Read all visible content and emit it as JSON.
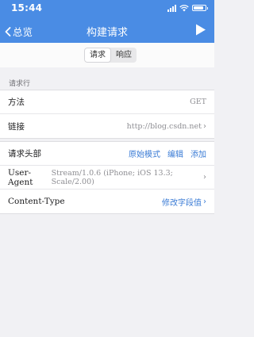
{
  "status": {
    "time": "15:44"
  },
  "nav": {
    "back_label": "总览",
    "title": "构建请求"
  },
  "segment": {
    "options": [
      "请求",
      "响应"
    ],
    "selected": "请求"
  },
  "request_line": {
    "section_label": "请求行",
    "method_label": "方法",
    "method_value": "GET",
    "url_label": "链接",
    "url_value": "http://blog.csdn.net"
  },
  "headers": {
    "title": "请求头部",
    "actions": [
      "原始模式",
      "编辑",
      "添加"
    ],
    "items": [
      {
        "name": "User-Agent",
        "value": "Stream/1.0.6 (iPhone; iOS 13.3; Scale/2.00)"
      },
      {
        "name": "Content-Type",
        "value": "修改字段值"
      }
    ]
  },
  "colors": {
    "nav_bg": "#4a8ce4",
    "accent": "#3a7bd5",
    "page_bg": "#f1f1f4"
  }
}
